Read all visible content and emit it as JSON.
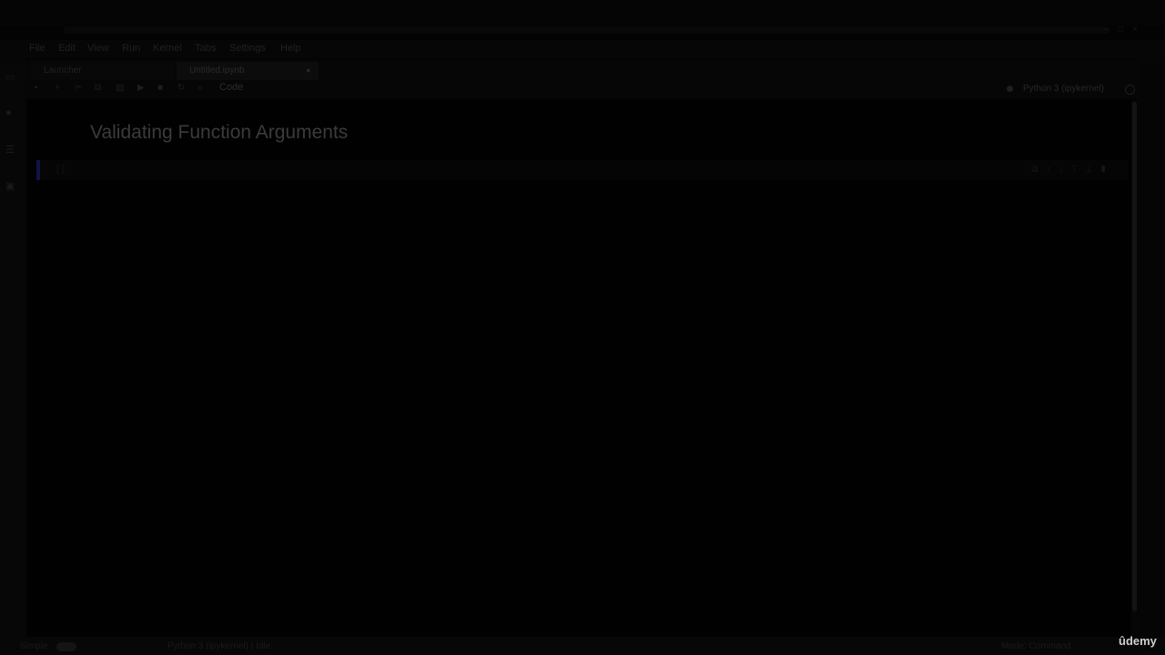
{
  "window": {
    "title": "",
    "controls": [
      "minimize-icon",
      "maximize-icon",
      "close-icon"
    ]
  },
  "menubar": {
    "items": [
      "File",
      "Edit",
      "View",
      "Run",
      "Kernel",
      "Tabs",
      "Settings",
      "Help"
    ]
  },
  "tabs": [
    {
      "label": "Launcher",
      "active": false
    },
    {
      "label": "Untitled.ipynb",
      "active": true
    }
  ],
  "toolbar": {
    "cell_type": "Code",
    "kernel_name": "Python 3 (ipykernel)",
    "icons": [
      "save-icon",
      "add-cell-icon",
      "cut-icon",
      "copy-icon",
      "paste-icon",
      "run-icon",
      "stop-icon",
      "restart-icon",
      "fast-forward-icon"
    ]
  },
  "notebook": {
    "heading": "Validating Function Arguments",
    "cell_prompt": "[ ]:"
  },
  "statusbar": {
    "mode": "Simple",
    "kernel_status": "Python 3 (ipykernel) | Idle",
    "right_text": "Mode: Command"
  },
  "watermark": "ûdemy",
  "colors": {
    "background": "#030303",
    "active_cell_marker": "#121244",
    "watermark": "#cfcfcf"
  }
}
